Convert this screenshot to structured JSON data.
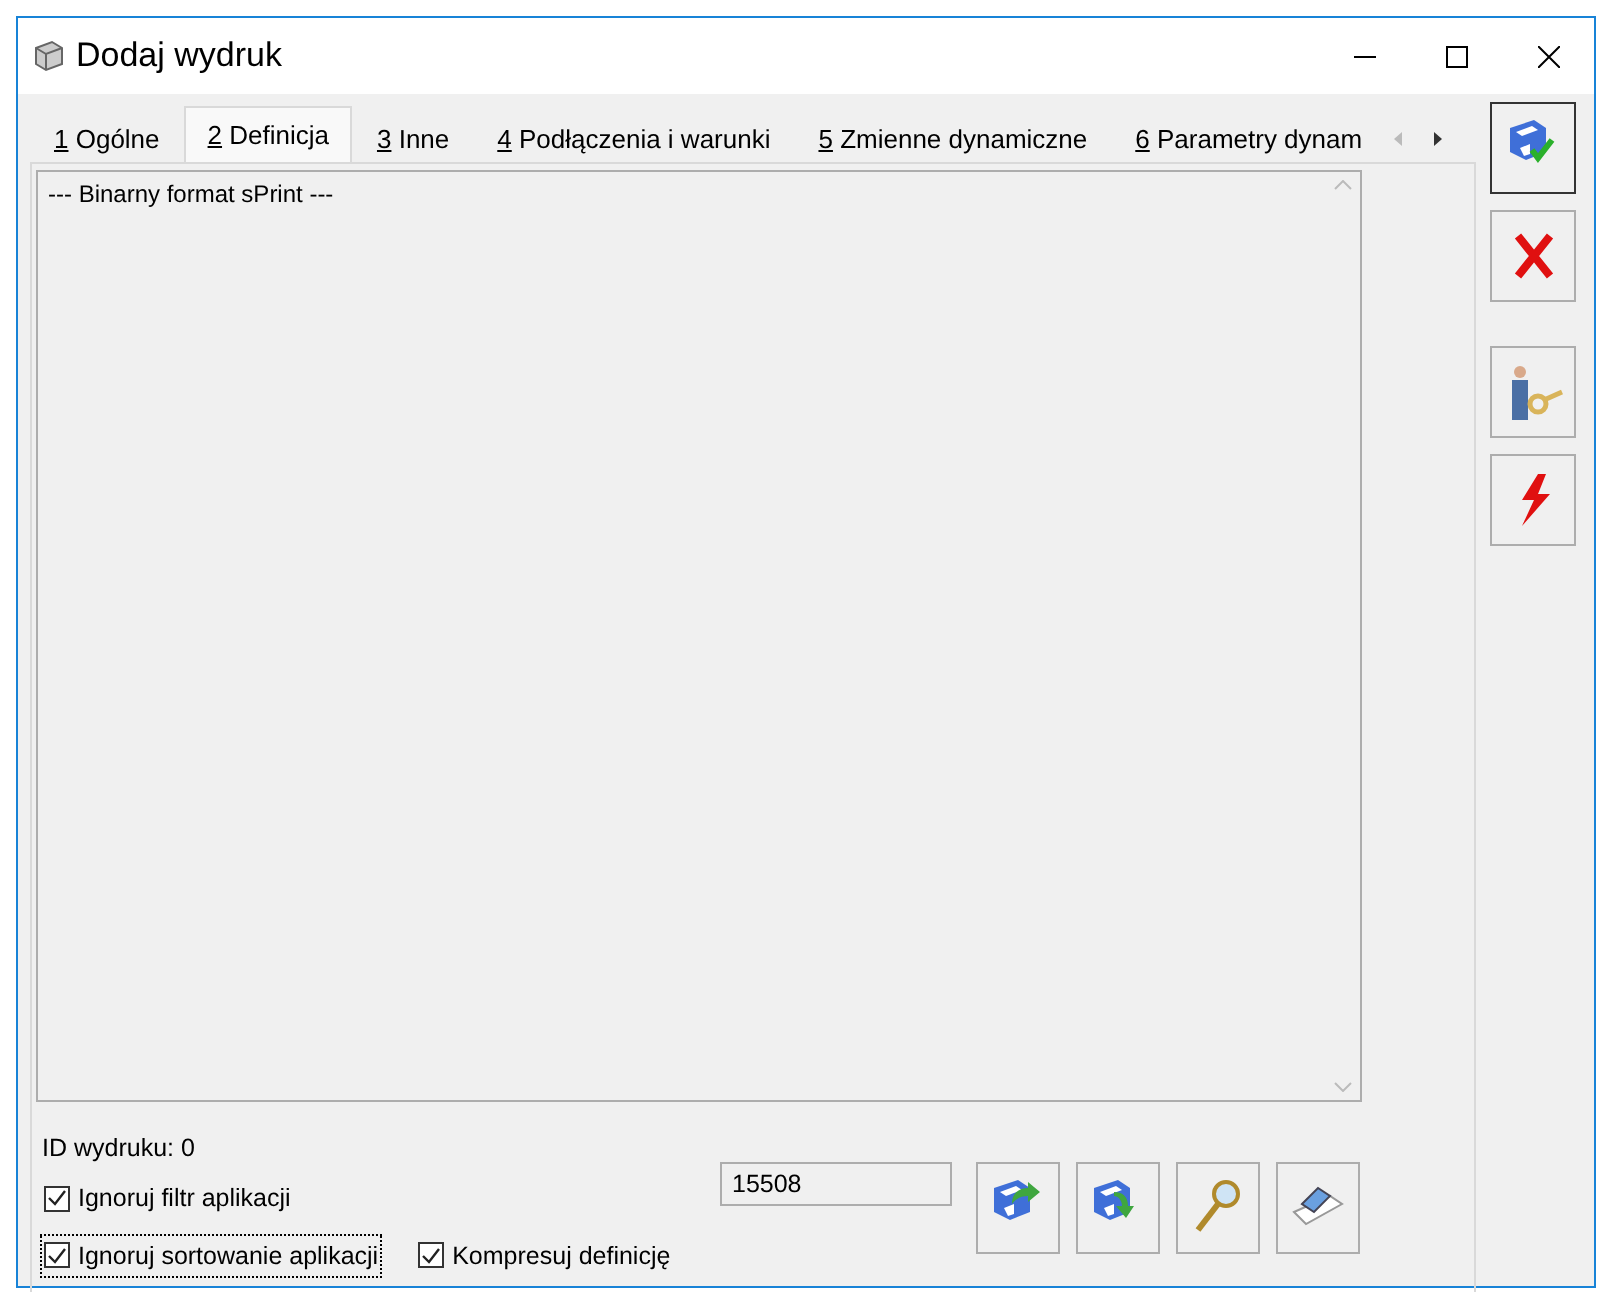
{
  "window": {
    "title": "Dodaj wydruk"
  },
  "tabs": [
    {
      "key": "1",
      "label": "Ogólne",
      "selected": false
    },
    {
      "key": "2",
      "label": "Definicja",
      "selected": true
    },
    {
      "key": "3",
      "label": "Inne",
      "selected": false
    },
    {
      "key": "4",
      "label": "Podłączenia i warunki",
      "selected": false
    },
    {
      "key": "5",
      "label": "Zmienne dynamiczne",
      "selected": false
    },
    {
      "key": "6",
      "label": "Parametry dynam",
      "selected": false
    }
  ],
  "definition": {
    "text": "--- Binarny format sPrint ---"
  },
  "id_label": "ID wydruku: 0",
  "checkboxes": [
    {
      "label": "Ignoruj filtr aplikacji",
      "checked": true,
      "focused": false
    },
    {
      "label": "Ignoruj sortowanie aplikacji",
      "checked": true,
      "focused": true
    },
    {
      "label": "Kompresuj definicję",
      "checked": true,
      "focused": false
    }
  ],
  "size_field": {
    "value": "15508"
  },
  "bottom_buttons": [
    {
      "kind": "import"
    },
    {
      "kind": "export"
    },
    {
      "kind": "preview"
    },
    {
      "kind": "clear"
    }
  ],
  "side_buttons": [
    {
      "kind": "save",
      "selected": true
    },
    {
      "kind": "cancel",
      "selected": false
    },
    {
      "kind": "permissions",
      "selected": false
    },
    {
      "kind": "run",
      "selected": false
    }
  ]
}
